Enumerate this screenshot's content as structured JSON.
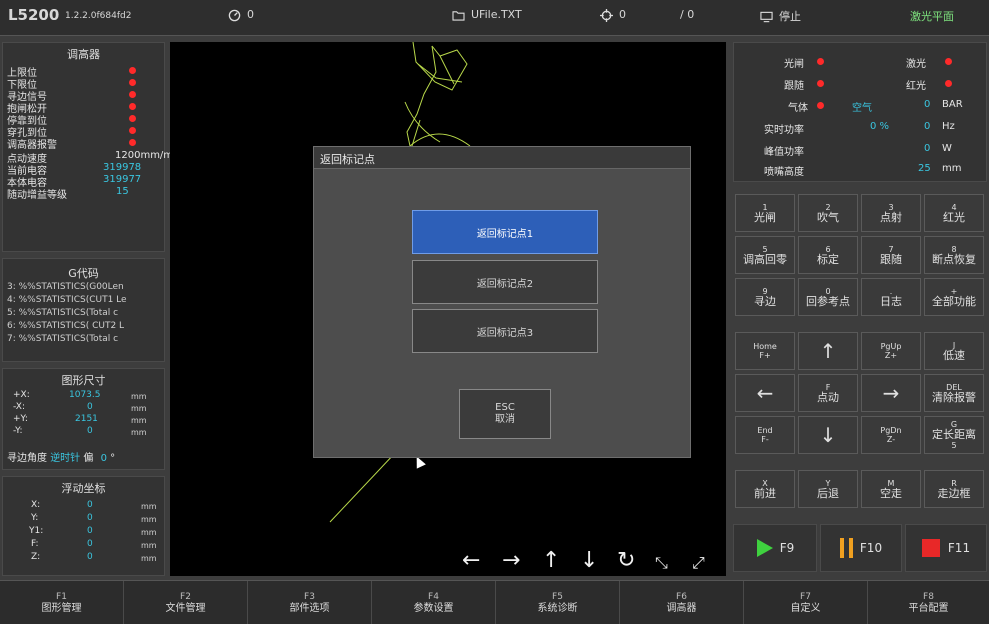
{
  "topbar": {
    "model": "L5200",
    "version": "1.2.2.0f684fd2",
    "speed_value": "0",
    "file_name": "UFile.TXT",
    "position_value": "0",
    "count_value": "/ 0",
    "status": "停止",
    "laser_plane": "激光平面"
  },
  "height_controller": {
    "title": "调高器",
    "signals": [
      "上限位",
      "下限位",
      "寻边信号",
      "抱闸松开",
      "停靠到位",
      "穿孔到位",
      "调高器报警"
    ],
    "jog_speed_label": "点动速度",
    "jog_speed_value": "1200mm/m",
    "current_cap_label": "当前电容",
    "current_cap_value": "319978",
    "body_cap_label": "本体电容",
    "body_cap_value": "319977",
    "follow_gain_label": "随动增益等级",
    "follow_gain_value": "15"
  },
  "gcode": {
    "title": "G代码",
    "lines": [
      "3: %%STATISTICS(G00Len",
      "4: %%STATISTICS(CUT1 Le",
      "5: %%STATISTICS(Total c",
      "6: %%STATISTICS( CUT2 L",
      "7: %%STATISTICS(Total c"
    ]
  },
  "shape_size": {
    "title": "图形尺寸",
    "rows": [
      {
        "label": "+X:",
        "value": "1073.5",
        "unit": "mm"
      },
      {
        "label": "-X:",
        "value": "0",
        "unit": "mm"
      },
      {
        "label": "+Y:",
        "value": "2151",
        "unit": "mm"
      },
      {
        "label": "-Y:",
        "value": "0",
        "unit": "mm"
      }
    ],
    "edge_angle_label": "寻边角度",
    "edge_angle_dir": "逆时针",
    "edge_angle_offset": "偏",
    "edge_angle_value": "0",
    "edge_angle_unit": "°"
  },
  "float_coords": {
    "title": "浮动坐标",
    "rows": [
      {
        "label": "X:",
        "value": "0",
        "unit": "mm"
      },
      {
        "label": "Y:",
        "value": "0",
        "unit": "mm"
      },
      {
        "label": "Y1:",
        "value": "0",
        "unit": "mm"
      },
      {
        "label": "F:",
        "value": "0",
        "unit": "mm"
      },
      {
        "label": "Z:",
        "value": "0",
        "unit": "mm"
      }
    ]
  },
  "dialog": {
    "title": "返回标记点",
    "buttons": [
      "返回标记点1",
      "返回标记点2",
      "返回标记点3"
    ],
    "esc_top": "ESC",
    "esc_bottom": "取消"
  },
  "status_panel": {
    "shutter": "光闸",
    "laser": "激光",
    "follow": "跟随",
    "red_light": "红光",
    "gas": "气体",
    "gas_type": "空气",
    "gas_value": "0",
    "gas_unit": "BAR",
    "realtime_power": "实时功率",
    "realtime_power_pct": "0 %",
    "realtime_power_value": "0",
    "realtime_power_unit": "Hz",
    "peak_power": "峰值功率",
    "peak_power_value": "0",
    "peak_power_unit": "W",
    "nozzle_height": "喷嘴高度",
    "nozzle_height_value": "25",
    "nozzle_height_unit": "mm"
  },
  "keypad": [
    {
      "top": "1",
      "label": "光闸"
    },
    {
      "top": "2",
      "label": "吹气"
    },
    {
      "top": "3",
      "label": "点射"
    },
    {
      "top": "4",
      "label": "红光"
    },
    {
      "top": "5",
      "label": "调高回零"
    },
    {
      "top": "6",
      "label": "标定"
    },
    {
      "top": "7",
      "label": "跟随"
    },
    {
      "top": "8",
      "label": "断点恢复"
    },
    {
      "top": "9",
      "label": "寻边"
    },
    {
      "top": "0",
      "label": "回参考点"
    },
    {
      "top": ".",
      "label": "日志"
    },
    {
      "top": "+",
      "label": "全部功能"
    },
    {
      "top": "Home",
      "label": "F+"
    },
    {
      "top": "",
      "label": "↑"
    },
    {
      "top": "PgUp",
      "label": "Z+"
    },
    {
      "top": "J",
      "label": "低速"
    },
    {
      "top": "",
      "label": "←"
    },
    {
      "top": "F",
      "label": "点动"
    },
    {
      "top": "",
      "label": "→"
    },
    {
      "top": "DEL",
      "label": "清除报警"
    },
    {
      "top": "End",
      "label": "F-"
    },
    {
      "top": "",
      "label": "↓"
    },
    {
      "top": "PgDn",
      "label": "Z-"
    },
    {
      "top": "G",
      "label": "定长距离"
    },
    {
      "top": "X",
      "label": "前进"
    },
    {
      "top": "Y",
      "label": "后退"
    },
    {
      "top": "M",
      "label": "空走"
    },
    {
      "top": "R",
      "label": "走边框"
    }
  ],
  "extra_g_value": "5",
  "function_keys": {
    "f9": "F9",
    "f10": "F10",
    "f11": "F11"
  },
  "bottom_bar": [
    {
      "key": "F1",
      "label": "图形管理"
    },
    {
      "key": "F2",
      "label": "文件管理"
    },
    {
      "key": "F3",
      "label": "部件选项"
    },
    {
      "key": "F4",
      "label": "参数设置"
    },
    {
      "key": "F5",
      "label": "系统诊断"
    },
    {
      "key": "F6",
      "label": "调高器"
    },
    {
      "key": "F7",
      "label": "自定义"
    },
    {
      "key": "F8",
      "label": "平台配置"
    }
  ],
  "canvas_arrows": [
    "←",
    "→",
    "↑",
    "↓",
    "↻",
    "⤡",
    "⤢"
  ]
}
